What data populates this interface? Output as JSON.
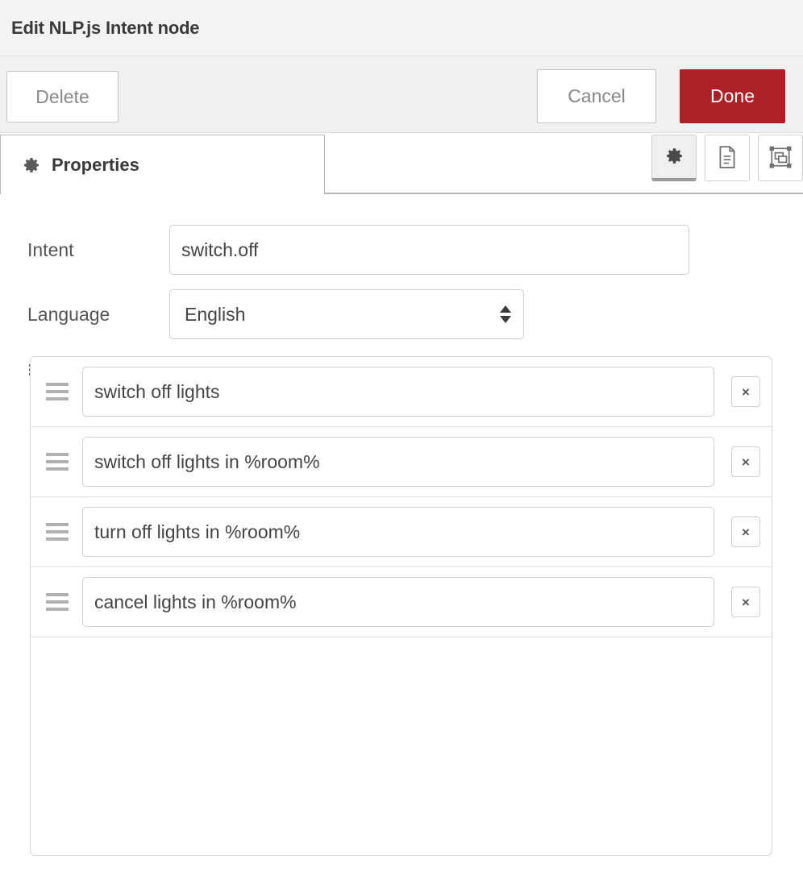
{
  "window": {
    "title": "Edit NLP.js Intent node"
  },
  "toolbar": {
    "delete_label": "Delete",
    "cancel_label": "Cancel",
    "done_label": "Done",
    "done_color": "#ad2028"
  },
  "tabs": [
    {
      "label": "Properties",
      "icon": "gear-icon",
      "active": true
    }
  ],
  "icon_buttons": [
    {
      "name": "properties-icon-button",
      "icon": "gear-icon",
      "active": true
    },
    {
      "name": "description-icon-button",
      "icon": "document-icon",
      "active": false
    },
    {
      "name": "appearance-icon-button",
      "icon": "node-appearance-icon",
      "active": false
    }
  ],
  "form": {
    "intent": {
      "label": "Intent",
      "value": "switch.off",
      "placeholder": ""
    },
    "language": {
      "label": "Language",
      "value": "English"
    }
  },
  "utterances": {
    "label": "Utterances",
    "icon": "list-icon",
    "delete_label": "×",
    "items": [
      {
        "value": "switch off lights"
      },
      {
        "value": "switch off lights in %room%"
      },
      {
        "value": "turn off lights in %room%"
      },
      {
        "value": "cancel lights in %room%"
      }
    ]
  }
}
